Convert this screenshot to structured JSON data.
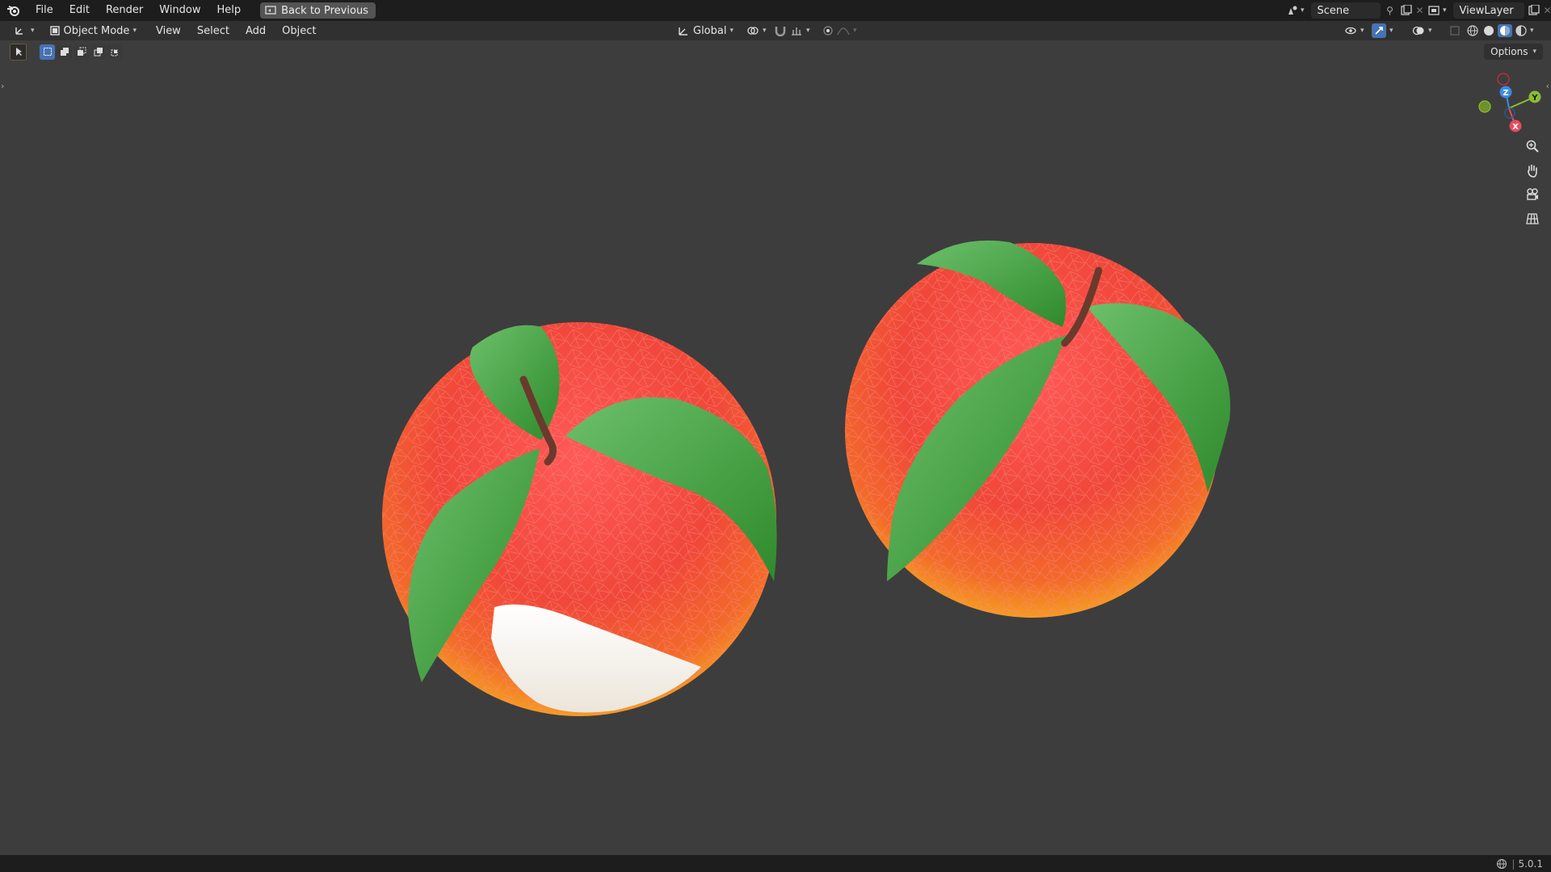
{
  "topbar": {
    "menus": [
      "File",
      "Edit",
      "Render",
      "Window",
      "Help"
    ],
    "back_label": "Back to Previous",
    "scene_label": "Scene",
    "viewlayer_label": "ViewLayer"
  },
  "header": {
    "mode_label": "Object Mode",
    "menus": [
      "View",
      "Select",
      "Add",
      "Object"
    ],
    "orientation_label": "Global"
  },
  "viewport": {
    "options_label": "Options",
    "gizmo_axes": {
      "z": "Z",
      "y": "Y",
      "x": "X"
    }
  },
  "status": {
    "version": "5.0.1"
  },
  "colors": {
    "background": "#3d3d3d",
    "accent": "#4772b3",
    "axis_x": "#e84b5e",
    "axis_y": "#8bbd32",
    "axis_z": "#3d8ae5"
  }
}
